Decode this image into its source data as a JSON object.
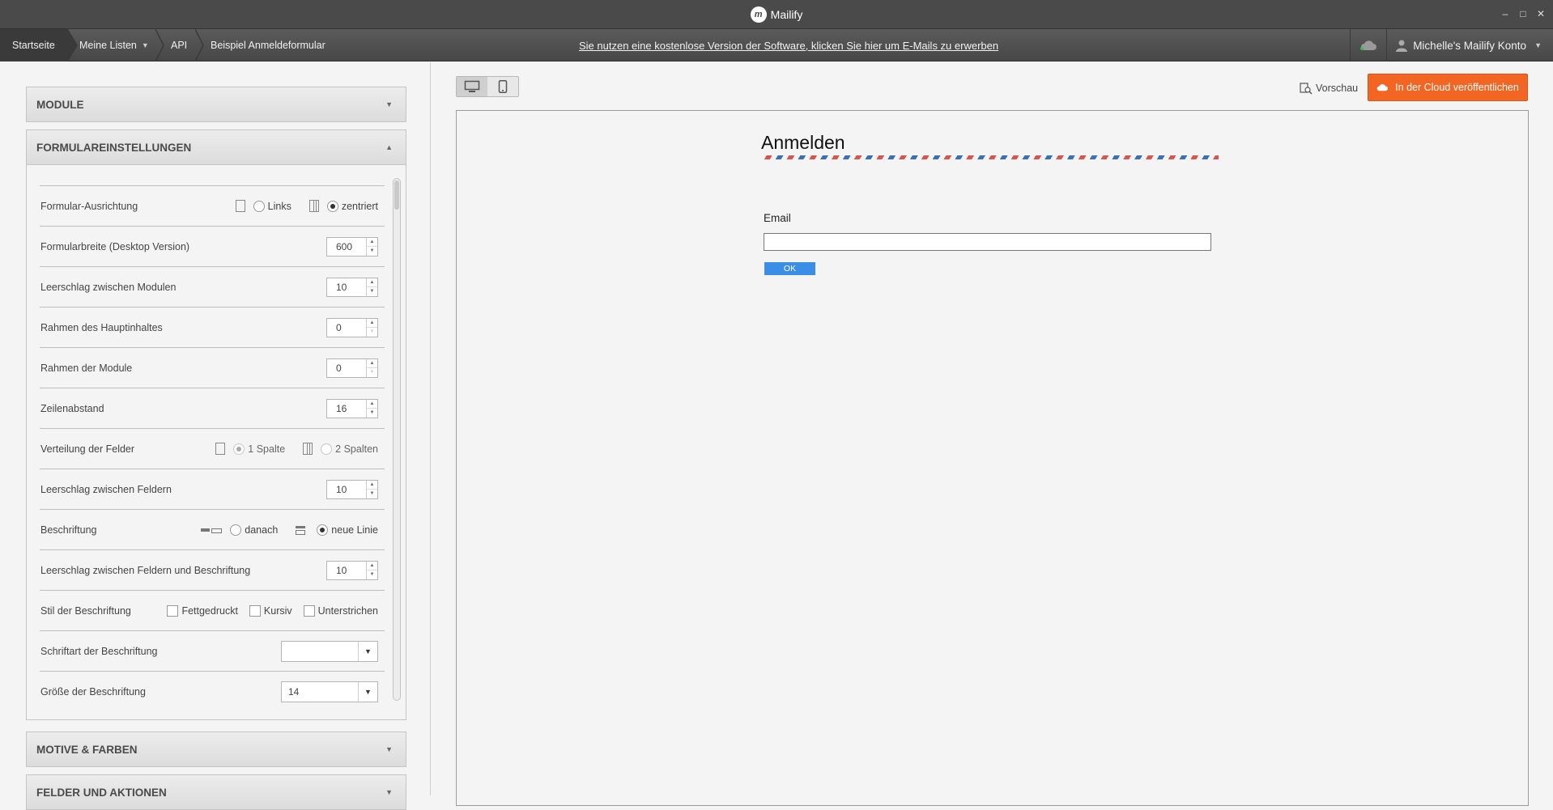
{
  "window": {
    "title": "Mailify",
    "logo_text": "m"
  },
  "nav": {
    "breadcrumbs": [
      {
        "label": "Startseite"
      },
      {
        "label": "Meine Listen"
      },
      {
        "label": "API"
      },
      {
        "label": "Beispiel Anmeldeformular"
      }
    ],
    "notice": "Sie nutzen eine kostenlose Version der Software, klicken Sie hier um E-Mails zu erwerben",
    "account": "Michelle's Mailify Konto"
  },
  "sidebar": {
    "sections": {
      "module": "MODULE",
      "form_settings": "FORMULAREINSTELLUNGEN",
      "themes": "MOTIVE & FARBEN",
      "fields": "FELDER UND AKTIONEN"
    },
    "settings": {
      "alignment": {
        "label": "Formular-Ausrichtung",
        "opt_left": "Links",
        "opt_center": "zentriert"
      },
      "form_width": {
        "label": "Formularbreite (Desktop Version)",
        "value": "600"
      },
      "module_spacing": {
        "label": "Leerschlag zwischen Modulen",
        "value": "10"
      },
      "main_border": {
        "label": "Rahmen des Hauptinhaltes",
        "value": "0"
      },
      "module_border": {
        "label": "Rahmen der Module",
        "value": "0"
      },
      "line_height": {
        "label": "Zeilenabstand",
        "value": "16"
      },
      "distribution": {
        "label": "Verteilung der Felder",
        "opt_1": "1 Spalte",
        "opt_2": "2 Spalten"
      },
      "field_spacing": {
        "label": "Leerschlag zwischen Feldern",
        "value": "10"
      },
      "caption": {
        "label": "Beschriftung",
        "opt_after": "danach",
        "opt_newline": "neue Linie"
      },
      "caption_spacing": {
        "label": "Leerschlag zwischen Feldern und Beschriftung",
        "value": "10"
      },
      "caption_style": {
        "label": "Stil der Beschriftung",
        "bold": "Fettgedruckt",
        "italic": "Kursiv",
        "underline": "Unterstrichen"
      },
      "caption_font": {
        "label": "Schriftart der Beschriftung",
        "value": ""
      },
      "caption_size": {
        "label": "Größe der Beschriftung",
        "value": "14"
      }
    }
  },
  "toolbar": {
    "preview": "Vorschau",
    "publish": "In der Cloud veröffentlichen"
  },
  "form": {
    "title": "Anmelden",
    "email_label": "Email",
    "email_value": "",
    "submit": "OK"
  },
  "colors": {
    "accent": "#f26522",
    "submit": "#3b8ee6",
    "airmail_red": "#d9534f",
    "airmail_blue": "#3b6fb6"
  }
}
